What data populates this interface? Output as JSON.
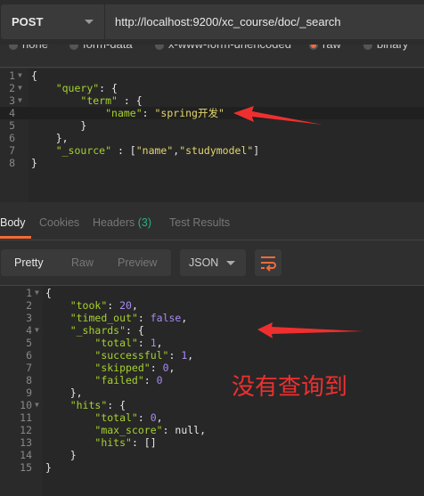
{
  "request": {
    "method": "POST",
    "url": "http://localhost:9200/xc_course/doc/_search"
  },
  "body_types": [
    {
      "label": "none",
      "selected": false
    },
    {
      "label": "form-data",
      "selected": false
    },
    {
      "label": "x-www-form-urlencoded",
      "selected": false
    },
    {
      "label": "raw",
      "selected": true
    },
    {
      "label": "binary",
      "selected": false
    }
  ],
  "request_body": [
    {
      "n": "1",
      "fold": true,
      "tokens": [
        [
          "p",
          "{"
        ]
      ]
    },
    {
      "n": "2",
      "fold": true,
      "tokens": [
        [
          "p",
          "    "
        ],
        [
          "k",
          "\"query\""
        ],
        [
          "p",
          ": {"
        ]
      ]
    },
    {
      "n": "3",
      "fold": true,
      "tokens": [
        [
          "p",
          "        "
        ],
        [
          "k",
          "\"term\""
        ],
        [
          "p",
          " : {"
        ]
      ]
    },
    {
      "n": "4",
      "fold": false,
      "hl": true,
      "tokens": [
        [
          "p",
          "            "
        ],
        [
          "k",
          "\"name\""
        ],
        [
          "p",
          ": "
        ],
        [
          "s",
          "\"spring开发\""
        ]
      ]
    },
    {
      "n": "5",
      "fold": false,
      "tokens": [
        [
          "p",
          "        }"
        ]
      ]
    },
    {
      "n": "6",
      "fold": false,
      "tokens": [
        [
          "p",
          "    },"
        ]
      ]
    },
    {
      "n": "7",
      "fold": false,
      "tokens": [
        [
          "p",
          "    "
        ],
        [
          "k",
          "\"_source\""
        ],
        [
          "p",
          " : ["
        ],
        [
          "s",
          "\"name\""
        ],
        [
          "p",
          ","
        ],
        [
          "s",
          "\"studymodel\""
        ],
        [
          "p",
          "]"
        ]
      ]
    },
    {
      "n": "8",
      "fold": false,
      "tokens": [
        [
          "p",
          "}"
        ]
      ]
    }
  ],
  "response_tabs": [
    {
      "label": "Body",
      "active": true
    },
    {
      "label": "Cookies",
      "active": false
    },
    {
      "label": "Headers",
      "count": "(3)",
      "active": false
    },
    {
      "label": "Test Results",
      "active": false
    }
  ],
  "view_modes": [
    {
      "label": "Pretty",
      "active": true
    },
    {
      "label": "Raw",
      "active": false
    },
    {
      "label": "Preview",
      "active": false
    }
  ],
  "format": "JSON",
  "wrap_icon": "wrap-lines-icon",
  "response_body": [
    {
      "n": "1",
      "fold": true,
      "tokens": [
        [
          "p",
          "{"
        ]
      ]
    },
    {
      "n": "2",
      "tokens": [
        [
          "p",
          "    "
        ],
        [
          "k",
          "\"took\""
        ],
        [
          "p",
          ": "
        ],
        [
          "n",
          "20"
        ],
        [
          "p",
          ","
        ]
      ]
    },
    {
      "n": "3",
      "tokens": [
        [
          "p",
          "    "
        ],
        [
          "k",
          "\"timed_out\""
        ],
        [
          "p",
          ": "
        ],
        [
          "n",
          "false"
        ],
        [
          "p",
          ","
        ]
      ]
    },
    {
      "n": "4",
      "fold": true,
      "tokens": [
        [
          "p",
          "    "
        ],
        [
          "k",
          "\"_shards\""
        ],
        [
          "p",
          ": {"
        ]
      ]
    },
    {
      "n": "5",
      "tokens": [
        [
          "p",
          "        "
        ],
        [
          "k",
          "\"total\""
        ],
        [
          "p",
          ": "
        ],
        [
          "n",
          "1"
        ],
        [
          "p",
          ","
        ]
      ]
    },
    {
      "n": "6",
      "tokens": [
        [
          "p",
          "        "
        ],
        [
          "k",
          "\"successful\""
        ],
        [
          "p",
          ": "
        ],
        [
          "n",
          "1"
        ],
        [
          "p",
          ","
        ]
      ]
    },
    {
      "n": "7",
      "tokens": [
        [
          "p",
          "        "
        ],
        [
          "k",
          "\"skipped\""
        ],
        [
          "p",
          ": "
        ],
        [
          "n",
          "0"
        ],
        [
          "p",
          ","
        ]
      ]
    },
    {
      "n": "8",
      "tokens": [
        [
          "p",
          "        "
        ],
        [
          "k",
          "\"failed\""
        ],
        [
          "p",
          ": "
        ],
        [
          "n",
          "0"
        ]
      ]
    },
    {
      "n": "9",
      "tokens": [
        [
          "p",
          "    },"
        ]
      ]
    },
    {
      "n": "10",
      "fold": true,
      "tokens": [
        [
          "p",
          "    "
        ],
        [
          "k",
          "\"hits\""
        ],
        [
          "p",
          ": {"
        ]
      ]
    },
    {
      "n": "11",
      "tokens": [
        [
          "p",
          "        "
        ],
        [
          "k",
          "\"total\""
        ],
        [
          "p",
          ": "
        ],
        [
          "n",
          "0"
        ],
        [
          "p",
          ","
        ]
      ]
    },
    {
      "n": "12",
      "tokens": [
        [
          "p",
          "        "
        ],
        [
          "k",
          "\"max_score\""
        ],
        [
          "p",
          ": null,"
        ]
      ]
    },
    {
      "n": "13",
      "tokens": [
        [
          "p",
          "        "
        ],
        [
          "k",
          "\"hits\""
        ],
        [
          "p",
          ": []"
        ]
      ]
    },
    {
      "n": "14",
      "tokens": [
        [
          "p",
          "    }"
        ]
      ]
    },
    {
      "n": "15",
      "tokens": [
        [
          "p",
          "}"
        ]
      ]
    }
  ],
  "annotation": {
    "text": "没有查询到",
    "color": "#ef2f2f"
  },
  "colors": {
    "accent": "#f26b3a",
    "key": "#a6d12e",
    "string": "#e2d66e",
    "number": "#a78bf0"
  }
}
